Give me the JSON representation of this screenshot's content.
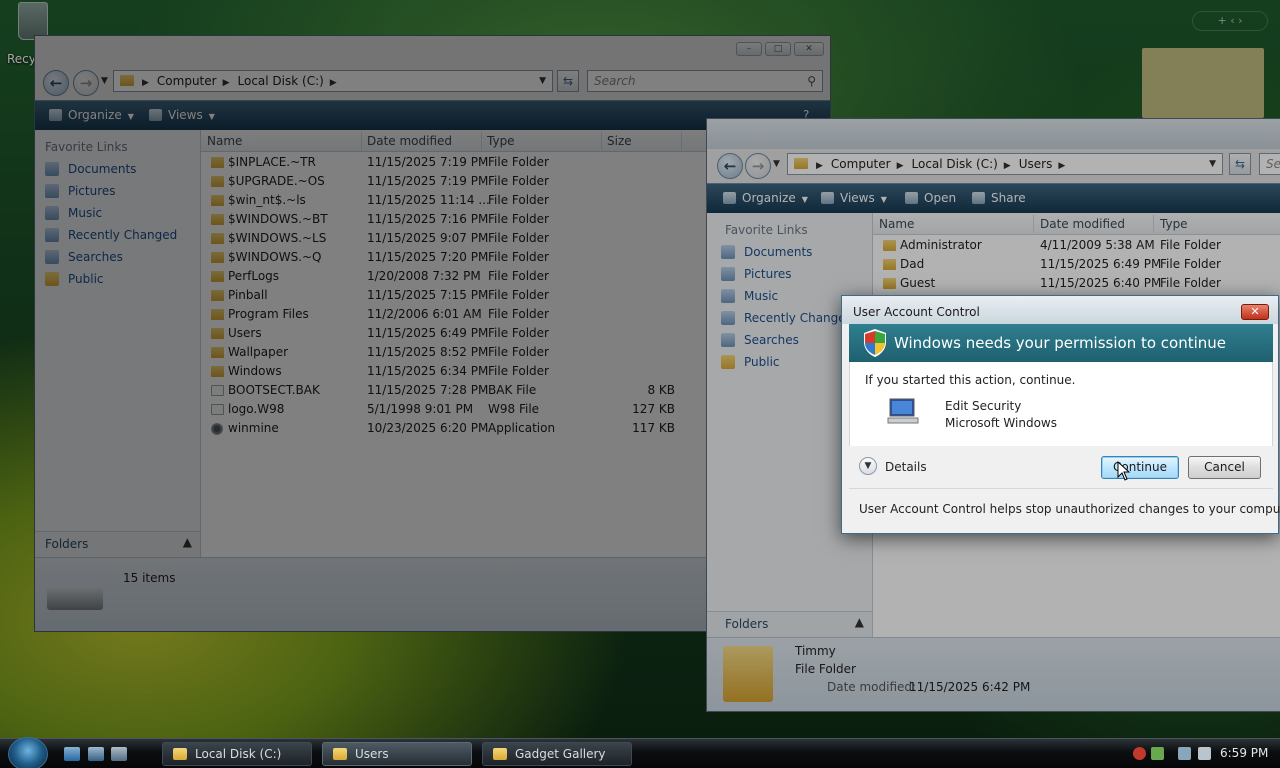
{
  "desktop": {
    "recycle_bin_label": "Recy"
  },
  "explorer_back": {
    "breadcrumb": [
      "Computer",
      "Local Disk (C:)"
    ],
    "search_placeholder": "Search",
    "toolbar": {
      "organize": "Organize",
      "views": "Views"
    },
    "nav": {
      "header": "Favorite Links",
      "links": [
        "Documents",
        "Pictures",
        "Music",
        "Recently Changed",
        "Searches",
        "Public"
      ]
    },
    "folders_label": "Folders",
    "columns": {
      "name": "Name",
      "date": "Date modified",
      "type": "Type",
      "size": "Size"
    },
    "files": [
      {
        "name": "$INPLACE.~TR",
        "date": "11/15/2025 7:19 PM",
        "type": "File Folder",
        "size": "",
        "icon": "folder"
      },
      {
        "name": "$UPGRADE.~OS",
        "date": "11/15/2025 7:19 PM",
        "type": "File Folder",
        "size": "",
        "icon": "folder"
      },
      {
        "name": "$win_nt$.~ls",
        "date": "11/15/2025 11:14 ...",
        "type": "File Folder",
        "size": "",
        "icon": "folder"
      },
      {
        "name": "$WINDOWS.~BT",
        "date": "11/15/2025 7:16 PM",
        "type": "File Folder",
        "size": "",
        "icon": "folder"
      },
      {
        "name": "$WINDOWS.~LS",
        "date": "11/15/2025 9:07 PM",
        "type": "File Folder",
        "size": "",
        "icon": "folder"
      },
      {
        "name": "$WINDOWS.~Q",
        "date": "11/15/2025 7:20 PM",
        "type": "File Folder",
        "size": "",
        "icon": "folder"
      },
      {
        "name": "PerfLogs",
        "date": "1/20/2008 7:32 PM",
        "type": "File Folder",
        "size": "",
        "icon": "folder"
      },
      {
        "name": "Pinball",
        "date": "11/15/2025 7:15 PM",
        "type": "File Folder",
        "size": "",
        "icon": "folder"
      },
      {
        "name": "Program Files",
        "date": "11/2/2006 6:01 AM",
        "type": "File Folder",
        "size": "",
        "icon": "folder"
      },
      {
        "name": "Users",
        "date": "11/15/2025 6:49 PM",
        "type": "File Folder",
        "size": "",
        "icon": "folder"
      },
      {
        "name": "Wallpaper",
        "date": "11/15/2025 8:52 PM",
        "type": "File Folder",
        "size": "",
        "icon": "folder"
      },
      {
        "name": "Windows",
        "date": "11/15/2025 6:34 PM",
        "type": "File Folder",
        "size": "",
        "icon": "folder"
      },
      {
        "name": "BOOTSECT.BAK",
        "date": "11/15/2025 7:28 PM",
        "type": "BAK File",
        "size": "8 KB",
        "icon": "doc"
      },
      {
        "name": "logo.W98",
        "date": "5/1/1998 9:01 PM",
        "type": "W98 File",
        "size": "127 KB",
        "icon": "doc"
      },
      {
        "name": "winmine",
        "date": "10/23/2025 6:20 PM",
        "type": "Application",
        "size": "117 KB",
        "icon": "app"
      }
    ],
    "item_count": "15 items"
  },
  "explorer_front": {
    "breadcrumb": [
      "Computer",
      "Local Disk (C:)",
      "Users"
    ],
    "search_placeholder": "Sea",
    "toolbar": {
      "organize": "Organize",
      "views": "Views",
      "open": "Open",
      "share": "Share"
    },
    "nav": {
      "header": "Favorite Links",
      "links": [
        "Documents",
        "Pictures",
        "Music",
        "Recently Changed",
        "Searches",
        "Public"
      ]
    },
    "folders_label": "Folders",
    "columns": {
      "name": "Name",
      "date": "Date modified",
      "type": "Type"
    },
    "files": [
      {
        "name": "Administrator",
        "date": "4/11/2009 5:38 AM",
        "type": "File Folder"
      },
      {
        "name": "Dad",
        "date": "11/15/2025 6:49 PM",
        "type": "File Folder"
      },
      {
        "name": "Guest",
        "date": "11/15/2025 6:40 PM",
        "type": "File Folder"
      }
    ],
    "details": {
      "name": "Timmy",
      "type": "File Folder",
      "date_label": "Date modified:",
      "date_value": "11/15/2025 6:42 PM"
    }
  },
  "uac": {
    "title": "User Account Control",
    "heading": "Windows needs your permission to continue",
    "prompt": "If you started this action, continue.",
    "program": "Edit Security",
    "publisher": "Microsoft Windows",
    "details_label": "Details",
    "continue_label": "Continue",
    "cancel_label": "Cancel",
    "footer": "User Account Control helps stop unauthorized changes to your computer."
  },
  "taskbar": {
    "tasks": [
      {
        "label": "Local Disk (C:)",
        "active": false
      },
      {
        "label": "Users",
        "active": true
      },
      {
        "label": "Gadget Gallery",
        "active": false
      }
    ],
    "clock": "6:59 PM"
  },
  "colors": {
    "accent": "#1f6070",
    "link": "#1e4f8c",
    "toolbar": "#173a52"
  }
}
